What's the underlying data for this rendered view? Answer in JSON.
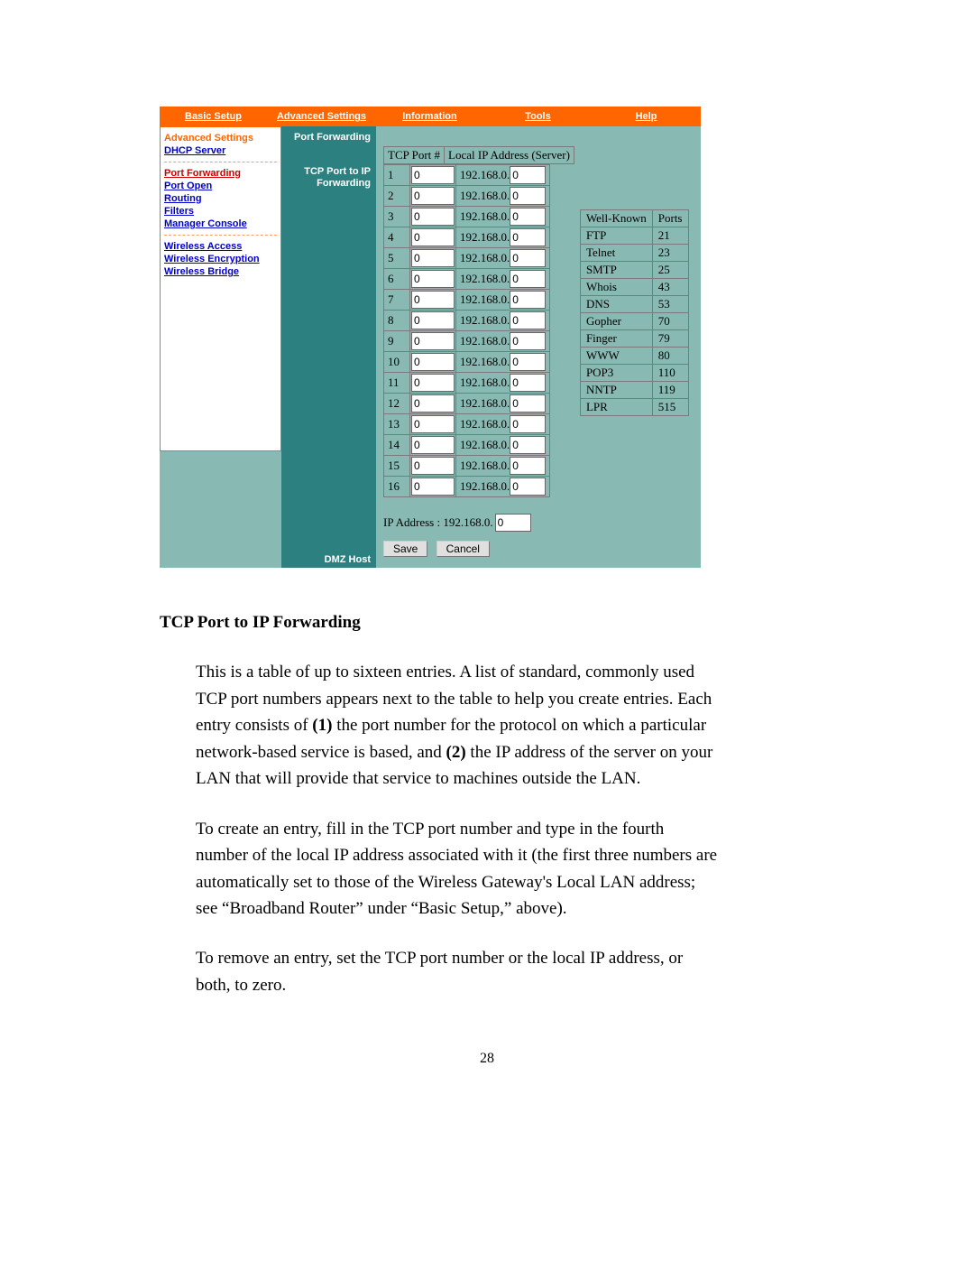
{
  "nav": {
    "basic": "Basic Setup",
    "advanced": "Advanced Settings",
    "information": "Information",
    "tools": "Tools",
    "help": "Help"
  },
  "sidebar": {
    "heading": "Advanced Settings",
    "dhcp": "DHCP Server",
    "portfwd": "Port Forwarding",
    "portopen": "Port Open",
    "routing": "Routing",
    "filters": "Filters",
    "manager": "Manager Console",
    "waccess": "Wireless Access",
    "wencrypt": "Wireless Encryption",
    "wbridge": "Wireless Bridge"
  },
  "midcol": {
    "hdr": "Port Forwarding",
    "sub1": "TCP Port to IP",
    "sub2": "Forwarding",
    "dmz": "DMZ Host"
  },
  "fwd": {
    "col_port": "TCP Port #",
    "col_ip": "Local IP Address (Server)",
    "rows": [
      {
        "n": "1",
        "port": "0",
        "ip_prefix": "192.168.0.",
        "host": "0"
      },
      {
        "n": "2",
        "port": "0",
        "ip_prefix": "192.168.0.",
        "host": "0"
      },
      {
        "n": "3",
        "port": "0",
        "ip_prefix": "192.168.0.",
        "host": "0"
      },
      {
        "n": "4",
        "port": "0",
        "ip_prefix": "192.168.0.",
        "host": "0"
      },
      {
        "n": "5",
        "port": "0",
        "ip_prefix": "192.168.0.",
        "host": "0"
      },
      {
        "n": "6",
        "port": "0",
        "ip_prefix": "192.168.0.",
        "host": "0"
      },
      {
        "n": "7",
        "port": "0",
        "ip_prefix": "192.168.0.",
        "host": "0"
      },
      {
        "n": "8",
        "port": "0",
        "ip_prefix": "192.168.0.",
        "host": "0"
      },
      {
        "n": "9",
        "port": "0",
        "ip_prefix": "192.168.0.",
        "host": "0"
      },
      {
        "n": "10",
        "port": "0",
        "ip_prefix": "192.168.0.",
        "host": "0"
      },
      {
        "n": "11",
        "port": "0",
        "ip_prefix": "192.168.0.",
        "host": "0"
      },
      {
        "n": "12",
        "port": "0",
        "ip_prefix": "192.168.0.",
        "host": "0"
      },
      {
        "n": "13",
        "port": "0",
        "ip_prefix": "192.168.0.",
        "host": "0"
      },
      {
        "n": "14",
        "port": "0",
        "ip_prefix": "192.168.0.",
        "host": "0"
      },
      {
        "n": "15",
        "port": "0",
        "ip_prefix": "192.168.0.",
        "host": "0"
      },
      {
        "n": "16",
        "port": "0",
        "ip_prefix": "192.168.0.",
        "host": "0"
      }
    ]
  },
  "dmz": {
    "label": "IP Address : 192.168.0.",
    "host": "0"
  },
  "buttons": {
    "save": "Save",
    "cancel": "Cancel"
  },
  "wellknown": {
    "hdr_name": "Well-Known",
    "hdr_port": "Ports",
    "rows": [
      {
        "name": "FTP",
        "port": "21"
      },
      {
        "name": "Telnet",
        "port": "23"
      },
      {
        "name": "SMTP",
        "port": "25"
      },
      {
        "name": "Whois",
        "port": "43"
      },
      {
        "name": "DNS",
        "port": "53"
      },
      {
        "name": "Gopher",
        "port": "70"
      },
      {
        "name": "Finger",
        "port": "79"
      },
      {
        "name": "WWW",
        "port": "80"
      },
      {
        "name": "POP3",
        "port": "110"
      },
      {
        "name": "NNTP",
        "port": "119"
      },
      {
        "name": "LPR",
        "port": "515"
      }
    ]
  },
  "doc": {
    "heading": "TCP Port to IP Forwarding",
    "p1a": "This is a table of up to sixteen entries. A list of standard, commonly used TCP port numbers appears next to the table to help you create entries. Each entry consists of ",
    "p1b": "(1)",
    "p1c": " the port number for the protocol on which a particular network-based service is based, and ",
    "p1d": "(2)",
    "p1e": " the IP address of the server on your LAN that will provide that service to machines outside the LAN.",
    "p2": "To create an entry, fill in the TCP port number and type in the fourth number of the local IP address associated with it (the first three numbers are automatically set to those of the Wireless Gateway's Local LAN address; see “Broadband Router” under “Basic Setup,” above).",
    "p3": "To remove an entry, set the TCP port number or the local IP address, or both, to zero.",
    "pagenum": "28"
  }
}
